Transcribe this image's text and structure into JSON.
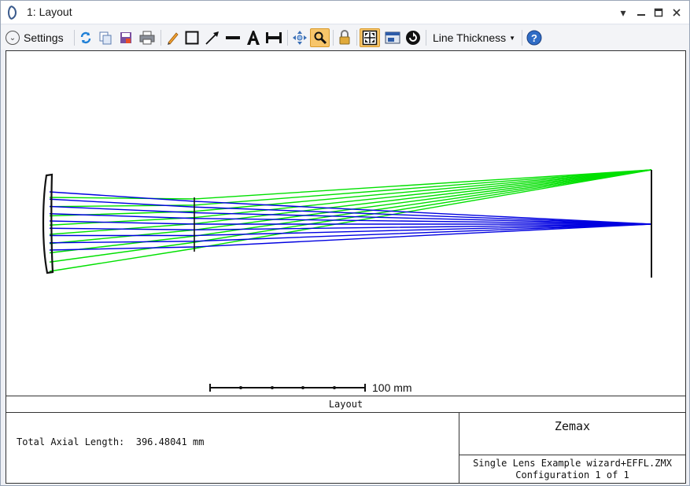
{
  "window": {
    "title": "1: Layout",
    "controls": [
      "dropdown-icon",
      "minimize-icon",
      "maximize-icon",
      "close-icon"
    ]
  },
  "toolbar": {
    "settings_label": "Settings",
    "line_thickness_label": "Line Thickness",
    "icons": [
      "refresh-icon",
      "copy-icon",
      "save-icon",
      "print-icon",
      "pencil-icon",
      "rectangle-icon",
      "arrow-line-icon",
      "line-icon",
      "text-icon",
      "dimension-icon",
      "pan-icon",
      "zoom-icon",
      "lock-icon",
      "fit-icon",
      "window-icon",
      "rotate-icon",
      "help-icon"
    ]
  },
  "plot": {
    "scale_bar_label": "100 mm",
    "ray_colors": {
      "field1": "#0000e0",
      "field2": "#00e000"
    },
    "title_row": "Layout",
    "axial_length_label": "Total Axial Length:",
    "axial_length_value": "396.48041 mm",
    "brand": "Zemax",
    "file_name": "Single Lens Example wizard+EFFL.ZMX",
    "configuration": "Configuration 1 of 1"
  }
}
